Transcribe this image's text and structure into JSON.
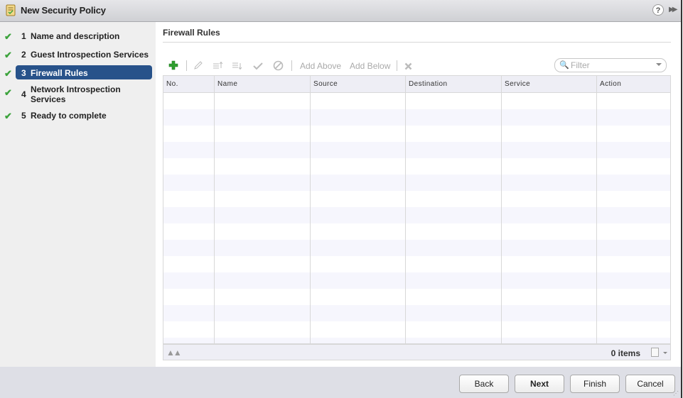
{
  "window": {
    "title": "New Security Policy",
    "title_icon": "policy-scroll-icon",
    "help_icon": "help-icon",
    "expand_icon": "double-chevron-right-icon"
  },
  "steps": [
    {
      "num": "1",
      "label": "Name and description",
      "done": true
    },
    {
      "num": "2",
      "label": "Guest Introspection Services",
      "done": true
    },
    {
      "num": "3",
      "label": "Firewall Rules",
      "done": true,
      "active": true
    },
    {
      "num": "4",
      "label": "Network Introspection Services",
      "done": true
    },
    {
      "num": "5",
      "label": "Ready to complete",
      "done": true
    }
  ],
  "main": {
    "section_title": "Firewall Rules",
    "toolbar": {
      "add_icon": "add-icon",
      "edit_icon": "pencil-icon",
      "move_up_icon": "move-up-icon",
      "move_down_icon": "move-down-icon",
      "enable_icon": "check-icon",
      "disable_icon": "block-icon",
      "add_above": "Add Above",
      "add_below": "Add Below",
      "delete_icon": "delete-x-icon"
    },
    "filter": {
      "placeholder": "Filter",
      "value": ""
    },
    "table": {
      "columns": [
        "No.",
        "Name",
        "Source",
        "Destination",
        "Service",
        "Action"
      ],
      "rows": []
    },
    "footer": {
      "items_count": "0 items",
      "find_icon": "binoculars-icon",
      "export_icon": "export-icon"
    }
  },
  "buttons": {
    "back": "Back",
    "next": "Next",
    "finish": "Finish",
    "cancel": "Cancel"
  },
  "colors": {
    "active_step": "#27528a",
    "check": "#3ca33c",
    "add_icon": "#2e9e2e"
  }
}
